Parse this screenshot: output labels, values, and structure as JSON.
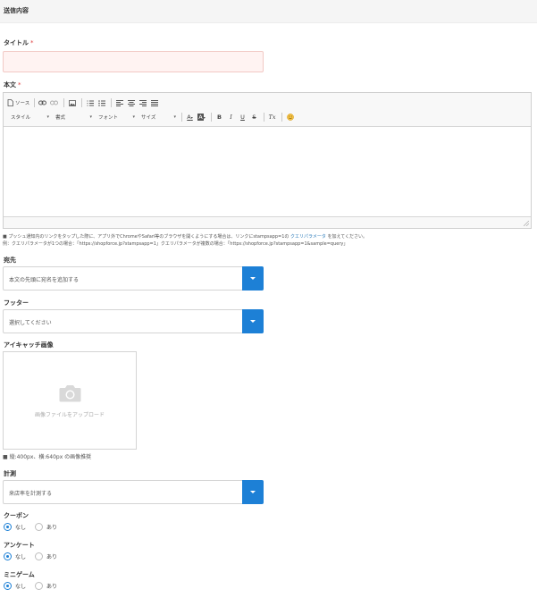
{
  "section": {
    "title": "送信内容"
  },
  "title_field": {
    "label": "タイトル",
    "required_mark": "*",
    "value": ""
  },
  "body_field": {
    "label": "本文",
    "required_mark": "*"
  },
  "toolbar": {
    "source": "ソース",
    "style": "スタイル",
    "format": "書式",
    "font": "フォント",
    "size": "サイズ",
    "bold": "B",
    "italic": "I",
    "underline": "U",
    "strike": "S",
    "clear_format": "Tx",
    "text_color": "A",
    "bg_color": "A"
  },
  "notes": {
    "line1_prefix": "■ プッシュ通知内のリンクをタップした際に、アプリ外でChromeやSafari等のブラウザを開くようにする場合は、リンクにstampsapp=1の ",
    "line1_link": "クエリパラメータ",
    "line1_suffix": " を加えてください。",
    "line2": "例：クエリパラメータが1つの場合：「https://shopforce.jp?stampsapp=1」クエリパラメータが複数の場合：「https://shopforce.jp?stampsapp=1&sample=query」"
  },
  "destination": {
    "label": "宛先",
    "value": "本文の先頭に宛名を追加する"
  },
  "footer": {
    "label": "フッター",
    "value": "選択してください"
  },
  "eyecatch": {
    "label": "アイキャッチ画像",
    "upload_text": "画像ファイルをアップロード",
    "hint": "■ 縦:400px、横:640px の画像推奨"
  },
  "measurement": {
    "label": "計測",
    "value": "来店率を計測する"
  },
  "coupon": {
    "label": "クーポン",
    "options": [
      "なし",
      "あり"
    ],
    "selected": 0
  },
  "survey": {
    "label": "アンケート",
    "options": [
      "なし",
      "あり"
    ],
    "selected": 0
  },
  "minigame": {
    "label": "ミニゲーム",
    "options": [
      "なし",
      "あり"
    ],
    "selected": 0
  },
  "colors": {
    "accent": "#1d80d6",
    "required": "#e04040",
    "title_input_bg": "#fff3f2"
  }
}
